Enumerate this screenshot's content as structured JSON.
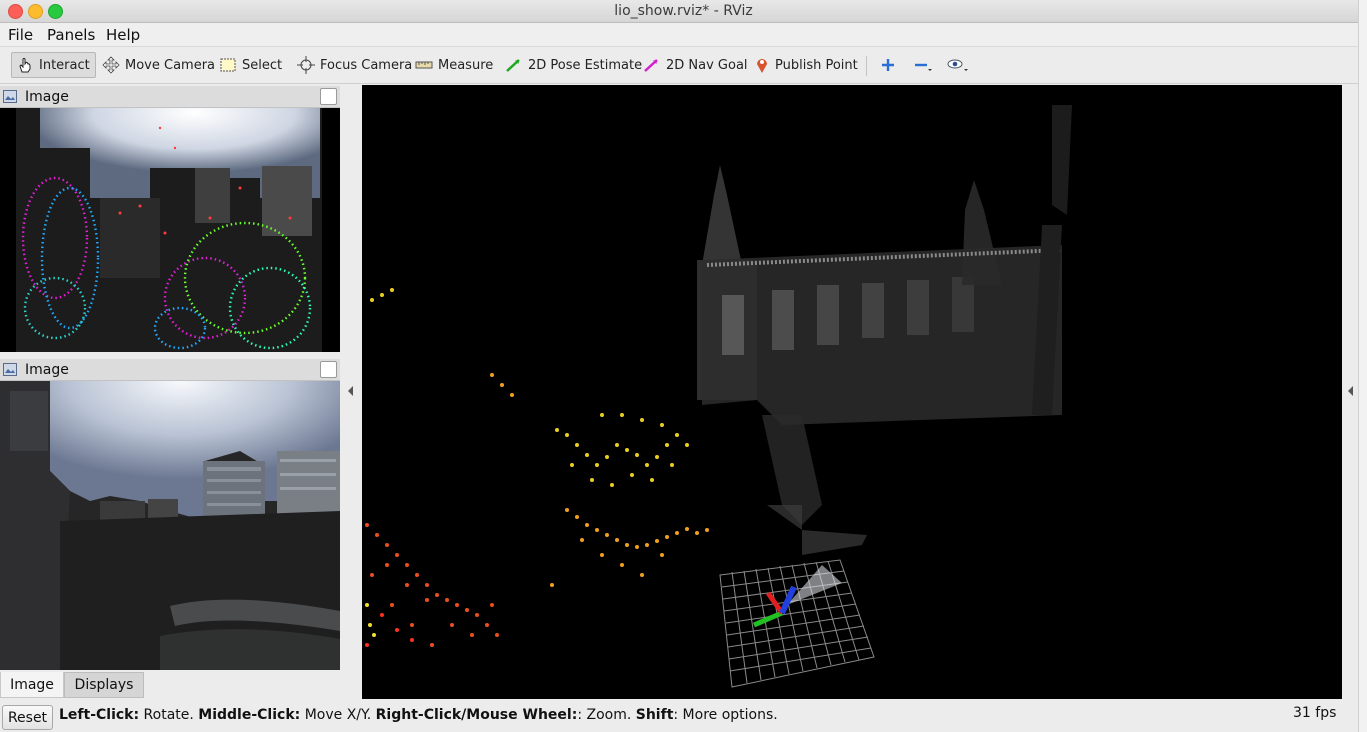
{
  "window": {
    "title": "lio_show.rviz* - RViz"
  },
  "menu": {
    "items": [
      "File",
      "Panels",
      "Help"
    ]
  },
  "toolbar": {
    "tools": [
      {
        "label": "Interact",
        "icon": "hand-pointer-icon",
        "active": true
      },
      {
        "label": "Move Camera",
        "icon": "move-arrows-icon",
        "active": false
      },
      {
        "label": "Select",
        "icon": "select-rect-icon",
        "active": false
      },
      {
        "label": "Focus Camera",
        "icon": "crosshair-icon",
        "active": false
      },
      {
        "label": "Measure",
        "icon": "ruler-icon",
        "active": false
      },
      {
        "label": "2D Pose Estimate",
        "icon": "green-arrow-icon",
        "active": false
      },
      {
        "label": "2D Nav Goal",
        "icon": "magenta-arrow-icon",
        "active": false
      },
      {
        "label": "Publish Point",
        "icon": "map-pin-icon",
        "active": false
      }
    ],
    "icon_buttons": [
      "add-tool-icon",
      "remove-tool-icon",
      "view-eye-icon"
    ]
  },
  "panels": {
    "image_top": {
      "title": "Image"
    },
    "image_bottom": {
      "title": "Image"
    }
  },
  "tabs": {
    "items": [
      "Image",
      "Displays"
    ],
    "selected": "Image"
  },
  "status": {
    "reset_label": "Reset",
    "hint_parts": [
      {
        "bold": "Left-Click:",
        "text": " Rotate. "
      },
      {
        "bold": "Middle-Click:",
        "text": " Move X/Y. "
      },
      {
        "bold": "Right-Click/Mouse Wheel:",
        "text": ": Zoom. "
      },
      {
        "bold": "Shift",
        "text": ": More options."
      }
    ],
    "fps": "31 fps"
  },
  "colors": {
    "viewport_bg": "#000000",
    "toolbar_bg": "#ececec",
    "accent_blue": "#2a6fd6"
  }
}
